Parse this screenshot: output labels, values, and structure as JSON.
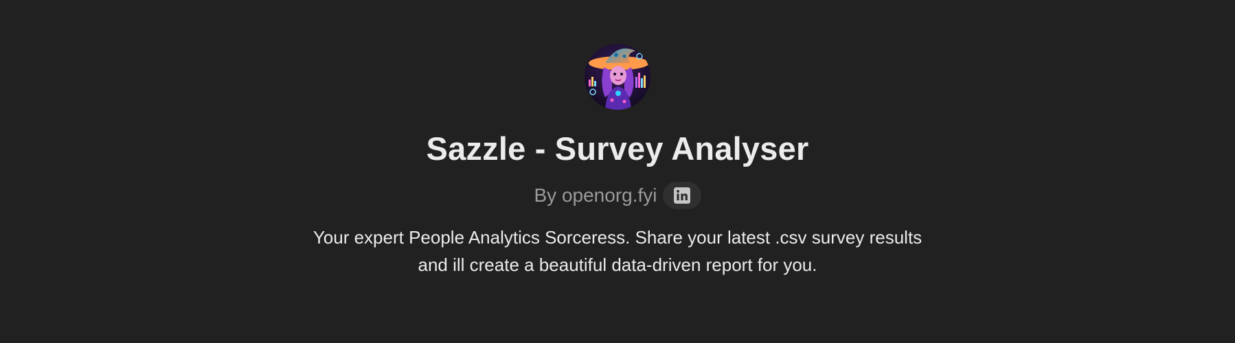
{
  "gpt": {
    "avatar_icon": "sorceress-avatar-icon",
    "title": "Sazzle - Survey Analyser",
    "byline": "By openorg.fyi",
    "social_icon": "linkedin-icon",
    "description": "Your expert People Analytics Sorceress. Share your latest .csv survey results and ill create a beautiful data-driven report for you."
  },
  "colors": {
    "background": "#212121",
    "title": "#ececec",
    "byline": "#9b9b9b",
    "chip": "#2f2f2f"
  }
}
